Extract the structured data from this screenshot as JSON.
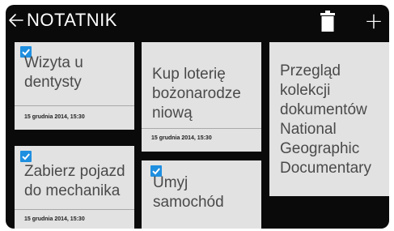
{
  "header": {
    "title": "NOTATNIK",
    "back_icon": "arrow-left-icon",
    "delete_icon": "trash-icon",
    "add_icon": "plus-icon",
    "add_symbol": "+"
  },
  "colors": {
    "background": "#0a0a0a",
    "card": "#e2e2e2",
    "checkbox": "#1f8fe0",
    "text": "#4a4a4a"
  },
  "notes": [
    {
      "title": "Wizyta u dentysty",
      "date": "15 grudnia 2014, 15:30",
      "checked": true
    },
    {
      "title": "Kup loterię bożonarodze niową",
      "date": "15 grudnia 2014, 15:30",
      "checked": false
    },
    {
      "title": "Przegląd kolekcji dokumentów National Geographic Documentary",
      "date": "",
      "checked": false
    },
    {
      "title": "Zabierz pojazd do mechanika",
      "date": "15 grudnia 2014, 15:30",
      "checked": true
    },
    {
      "title": "Umyj samochód",
      "date": "",
      "checked": true
    }
  ]
}
